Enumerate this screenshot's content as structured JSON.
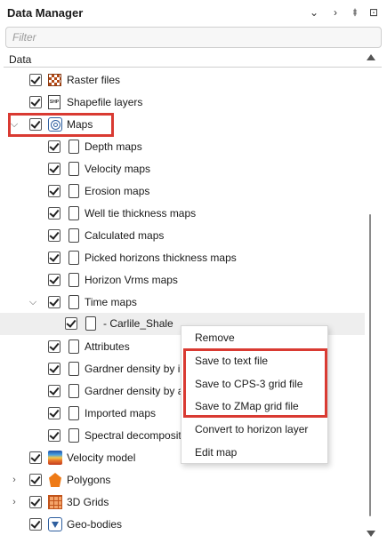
{
  "panel": {
    "title": "Data Manager",
    "title_buttons": [
      "⌄",
      "›",
      "⯒",
      "⊡"
    ]
  },
  "filter": {
    "placeholder": "Filter"
  },
  "column_header": "Data",
  "tree": {
    "raster_files": "Raster files",
    "shapefile_layers": "Shapefile layers",
    "shapefile_icon_text": "SHP",
    "maps": "Maps",
    "depth_maps": "Depth maps",
    "velocity_maps": "Velocity maps",
    "erosion_maps": "Erosion maps",
    "well_tie_thickness_maps": "Well tie thickness maps",
    "calculated_maps": "Calculated maps",
    "picked_horizons_thickness_maps": "Picked horizons thickness maps",
    "horizon_vrms_maps": "Horizon Vrms maps",
    "time_maps": "Time maps",
    "carlile_shale": "- Carlile_Shale",
    "attributes": "Attributes",
    "gardner_density_1": "Gardner density by i",
    "gardner_density_2": "Gardner density by a",
    "imported_maps": "Imported maps",
    "spectral_decomposition": "Spectral decomposit",
    "velocity_model": "Velocity model",
    "polygons": "Polygons",
    "grids_3d": "3D Grids",
    "geo_bodies": "Geo-bodies"
  },
  "context_menu": {
    "remove": "Remove",
    "save_text": "Save to text file",
    "save_cps3": "Save to CPS-3 grid file",
    "save_zmap": "Save to ZMap grid file",
    "convert_horizon": "Convert to horizon layer",
    "edit_map": "Edit map"
  },
  "highlight_color": "#d93a32",
  "selection_color": "#0d73d4"
}
